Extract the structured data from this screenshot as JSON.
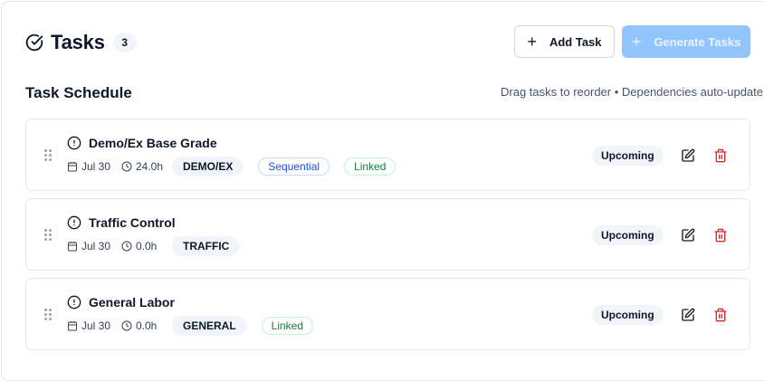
{
  "header": {
    "title": "Tasks",
    "count": "3",
    "add_button": "Add Task",
    "generate_button": "Generate Tasks"
  },
  "schedule": {
    "title": "Task Schedule",
    "hint": "Drag tasks to reorder • Dependencies auto-update"
  },
  "tasks": [
    {
      "name": "Demo/Ex Base Grade",
      "date": "Jul 30",
      "hours": "24.0h",
      "code": "DEMO/EX",
      "sequential": "Sequential",
      "linked": "Linked",
      "status": "Upcoming"
    },
    {
      "name": "Traffic Control",
      "date": "Jul 30",
      "hours": "0.0h",
      "code": "TRAFFIC",
      "status": "Upcoming"
    },
    {
      "name": "General Labor",
      "date": "Jul 30",
      "hours": "0.0h",
      "code": "GENERAL",
      "linked": "Linked",
      "status": "Upcoming"
    }
  ],
  "icons": {
    "title": "circle-check-icon",
    "task": "alert-circle-icon",
    "date": "calendar-icon",
    "hours": "clock-icon",
    "edit": "edit-icon",
    "delete": "trash-icon",
    "drag": "grip-vertical-icon",
    "add": "plus-icon"
  },
  "colors": {
    "primary_disabled": "#93c5fd",
    "danger": "#dc2626",
    "sequential": "#1d4ed8",
    "linked": "#15803d"
  }
}
